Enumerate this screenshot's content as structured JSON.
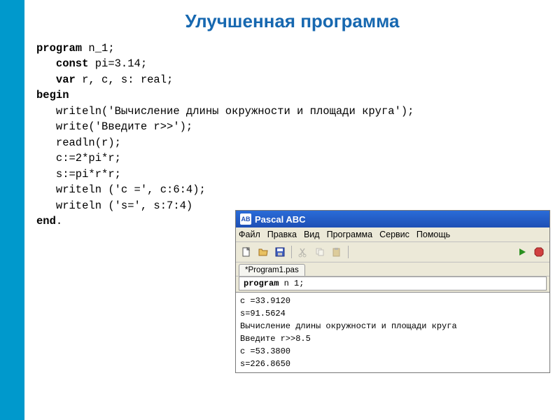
{
  "title": "Улучшенная программа",
  "code": {
    "l1a": "program",
    "l1b": " n_1;",
    "l2a": "   const",
    "l2b": " pi=3.14;",
    "l3a": "   var",
    "l3b": " r, c, s: real;",
    "l4a": "begin",
    "l5": "   writeln('Вычисление длины окружности и площади круга');",
    "l6": "   write('Введите r>>');",
    "l7": "   readln(r);",
    "l8": "   c:=2*pi*r;",
    "l9": "   s:=pi*r*r;",
    "l10": "   writeln ('c =', c:6:4);",
    "l11": "   writeln ('s=', s:7:4)",
    "l12a": "end",
    "l12b": "."
  },
  "ide": {
    "icon": "AB",
    "title": "Pascal ABC",
    "menu": {
      "file": "Файл",
      "edit": "Правка",
      "view": "Вид",
      "program": "Программа",
      "service": "Сервис",
      "help": "Помощь"
    },
    "tab": "*Program1.pas",
    "codeline_kw": "program",
    "codeline_rest": " n 1;",
    "output": {
      "l1": "c =33.9120",
      "l2": "s=91.5624",
      "l3": "Вычисление длины окружности и площади круга",
      "l4": "Введите r>>8.5",
      "l5": "c =53.3800",
      "l6": "s=226.8650"
    }
  }
}
